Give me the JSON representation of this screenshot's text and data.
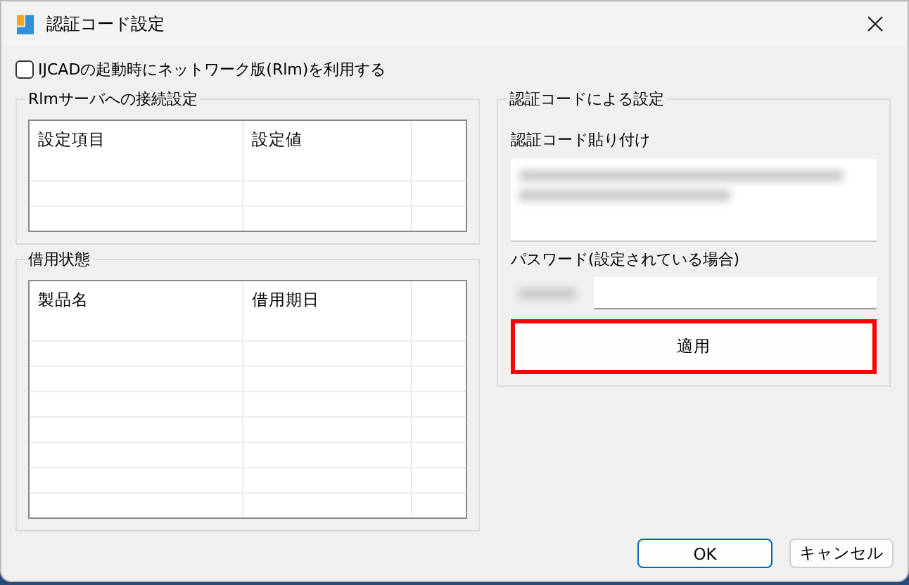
{
  "window": {
    "title": "認証コード設定"
  },
  "network_checkbox": {
    "label": "IJCADの起動時にネットワーク版(Rlm)を利用する",
    "checked": false
  },
  "server_group": {
    "title": "Rlmサーバへの接続設定",
    "columns": [
      "設定項目",
      "設定値"
    ]
  },
  "borrow_group": {
    "title": "借用状態",
    "columns": [
      "製品名",
      "借用期日"
    ]
  },
  "auth_group": {
    "title": "認証コードによる設定",
    "code_label": "認証コード貼り付け",
    "password_label": "パスワード(設定されている場合)",
    "apply_button": {
      "label": "適用",
      "highlighted": true
    }
  },
  "buttons": [
    {
      "label": "OK",
      "kind": "default"
    },
    {
      "label": "キャンセル",
      "kind": "normal"
    }
  ]
}
